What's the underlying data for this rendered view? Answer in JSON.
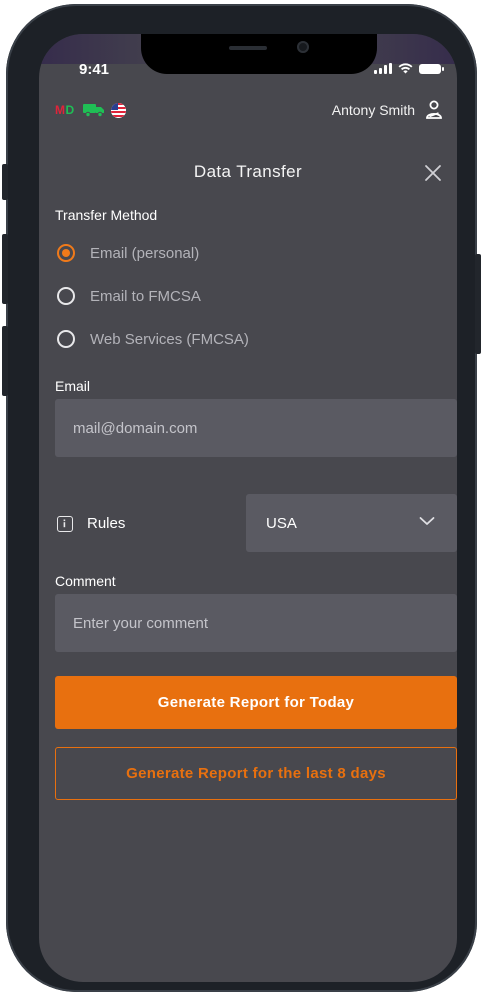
{
  "status_bar": {
    "time": "9:41"
  },
  "header": {
    "badge_m": "M",
    "badge_d": "D",
    "user_name": "Antony Smith"
  },
  "dialog": {
    "title": "Data Transfer",
    "transfer_method_label": "Transfer Method",
    "options": [
      {
        "label": "Email (personal)",
        "selected": true
      },
      {
        "label": "Email to FMCSA",
        "selected": false
      },
      {
        "label": "Web Services (FMCSA)",
        "selected": false
      }
    ],
    "email_label": "Email",
    "email_placeholder": "mail@domain.com",
    "rules_label": "Rules",
    "rules_value": "USA",
    "comment_label": "Comment",
    "comment_placeholder": "Enter your comment",
    "primary_button": "Generate Report for Today",
    "secondary_button": "Generate Report for the last 8 days"
  },
  "colors": {
    "accent": "#e8700f",
    "screen_bg": "#48484e",
    "field_bg": "#5a5a62"
  }
}
